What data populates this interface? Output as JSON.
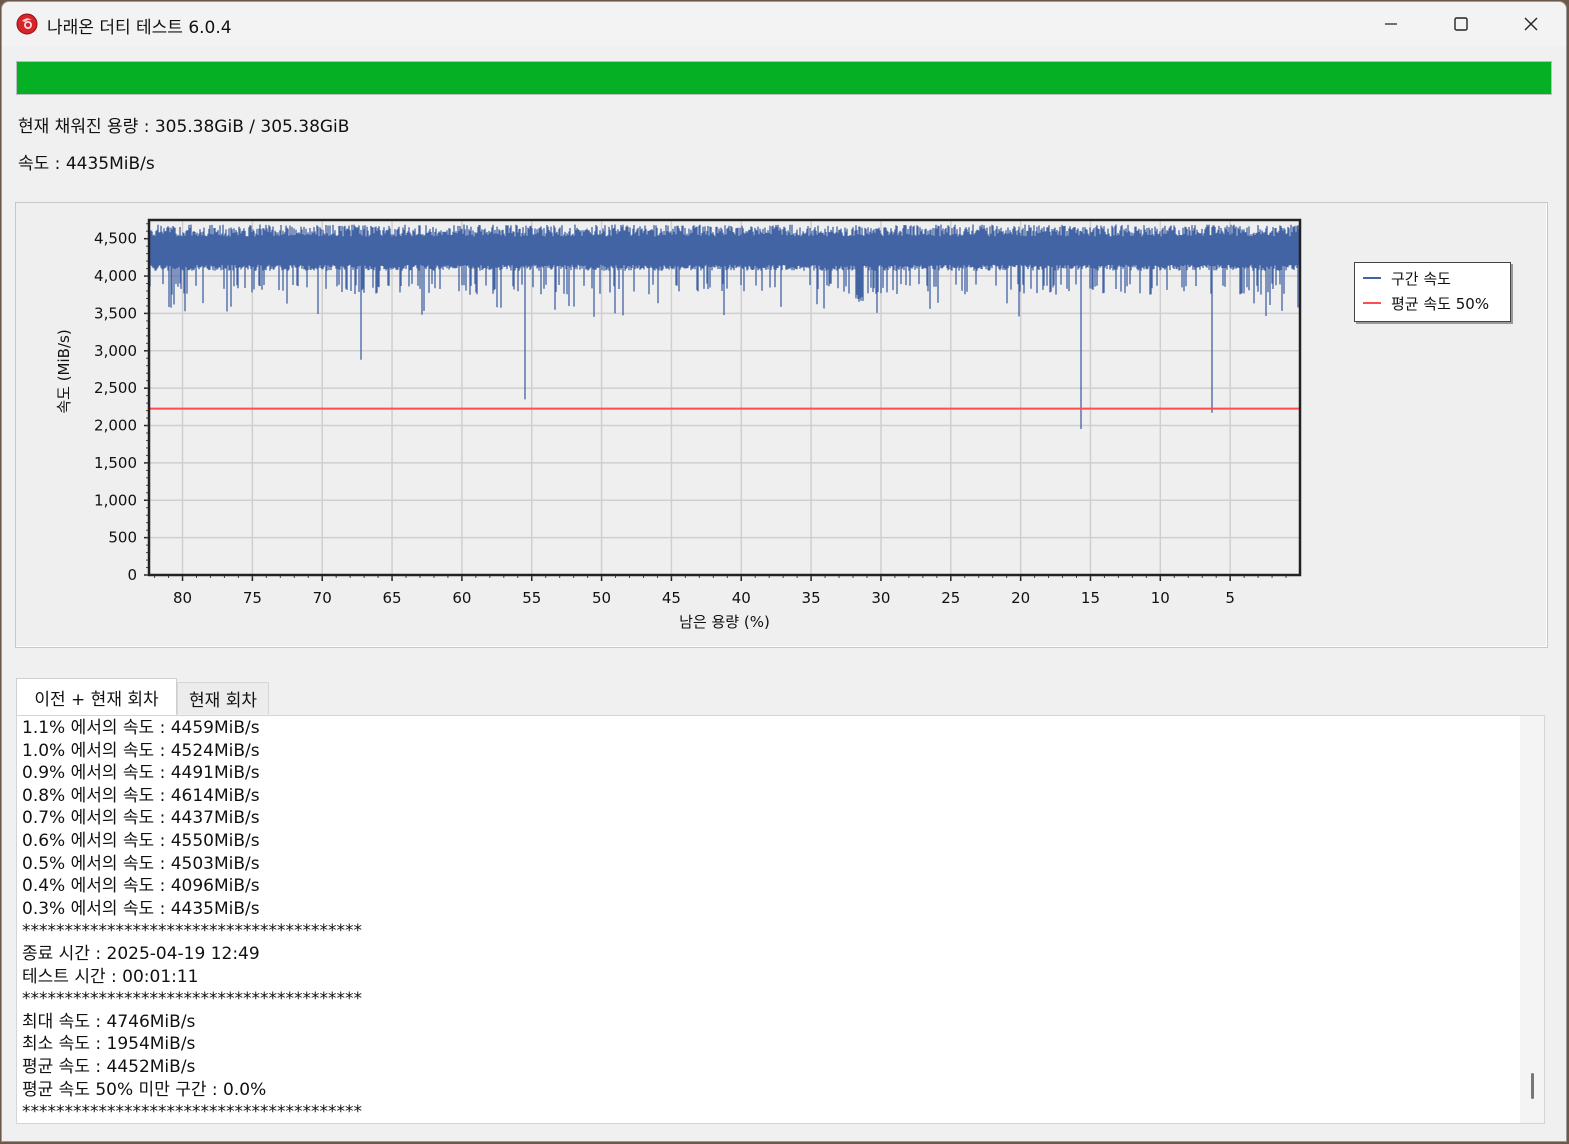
{
  "window": {
    "title": "나래온 더티 테스트 6.0.4",
    "controls": {
      "minimize": "minimize-icon",
      "maximize": "maximize-icon",
      "close": "close-icon"
    }
  },
  "progress": {
    "value_percent": 100,
    "color": "#06b025"
  },
  "info": {
    "filled_capacity": "현재 채워진 용량 : 305.38GiB / 305.38GiB",
    "speed": "속도 : 4435MiB/s"
  },
  "chart_data": {
    "type": "line",
    "xlabel": "남은 용량 (%)",
    "ylabel": "속도 (MiB/s)",
    "xlim": [
      82.4,
      0
    ],
    "ylim": [
      0,
      4750
    ],
    "x_ticks": [
      "80",
      "75",
      "70",
      "65",
      "60",
      "55",
      "50",
      "45",
      "40",
      "35",
      "30",
      "25",
      "20",
      "15",
      "10",
      "5"
    ],
    "y_ticks": [
      "0",
      "500",
      "1,000",
      "1,500",
      "2,000",
      "2,500",
      "3,000",
      "3,500",
      "4,000",
      "4,500"
    ],
    "grid": true,
    "legend_position": "right",
    "series": [
      {
        "name": "구간 속도",
        "color": "#4263a4",
        "style": "noisy band 4100–4650, mean ≈4400",
        "x": [
          82.4,
          80,
          78,
          76,
          74,
          72,
          70,
          68,
          67.2,
          66,
          64,
          62,
          60,
          58,
          56,
          55.5,
          54,
          52,
          50,
          48,
          46,
          44,
          42,
          40,
          38,
          36,
          34,
          32,
          30,
          28,
          26,
          24,
          22,
          20,
          18,
          16,
          15.7,
          14,
          12,
          10,
          8,
          6.3,
          4,
          2,
          0
        ],
        "y": [
          4420,
          4380,
          4410,
          4370,
          4400,
          4390,
          4420,
          4380,
          2880,
          4410,
          4390,
          4400,
          4370,
          4420,
          4400,
          2350,
          4380,
          4410,
          4390,
          4400,
          4380,
          4410,
          4390,
          4400,
          4380,
          4410,
          4400,
          4300,
          4390,
          4410,
          4380,
          4400,
          4390,
          4410,
          4380,
          4400,
          1954,
          4400,
          4390,
          4410,
          4380,
          2170,
          4400,
          4420,
          4400
        ]
      },
      {
        "name": "평균 속도 50%",
        "color": "#ff4d4d",
        "x": [
          82.4,
          0
        ],
        "y": [
          2226,
          2226
        ]
      }
    ]
  },
  "tabs": [
    {
      "label": "이전 + 현재 회차",
      "active": true
    },
    {
      "label": "현재 회차",
      "active": false
    }
  ],
  "log": [
    "1.1% 에서의 속도 : 4459MiB/s",
    "1.0% 에서의 속도 : 4524MiB/s",
    "0.9% 에서의 속도 : 4491MiB/s",
    "0.8% 에서의 속도 : 4614MiB/s",
    "0.7% 에서의 속도 : 4437MiB/s",
    "0.6% 에서의 속도 : 4550MiB/s",
    "0.5% 에서의 속도 : 4503MiB/s",
    "0.4% 에서의 속도 : 4096MiB/s",
    "0.3% 에서의 속도 : 4435MiB/s",
    "****************************************",
    "종료 시간 : 2025-04-19 12:49",
    "테스트 시간 : 00:01:11",
    "****************************************",
    "최대 속도 : 4746MiB/s",
    "최소 속도 : 1954MiB/s",
    "평균 속도 : 4452MiB/s",
    "평균 속도 50% 미만 구간 : 0.0%",
    "****************************************"
  ]
}
